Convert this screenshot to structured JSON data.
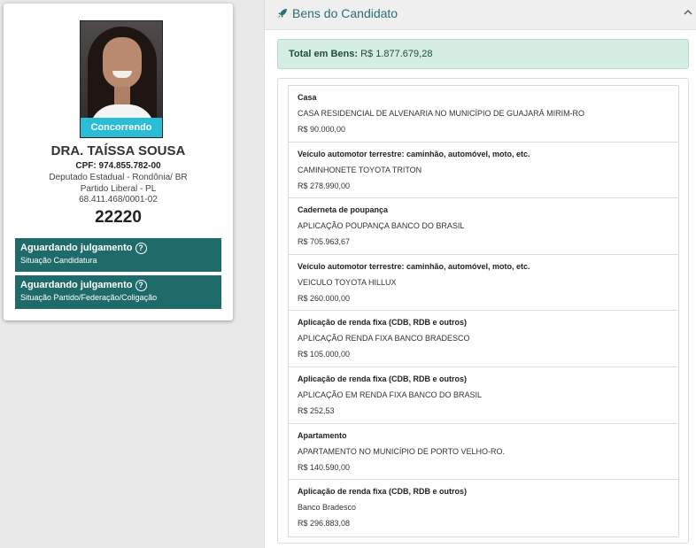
{
  "candidate": {
    "status_ribbon": "Concorrendo",
    "name": "DRA. TAÍSSA SOUSA",
    "cpf": "CPF: 974.855.782-00",
    "role": "Deputado Estadual - Rondônia/ BR",
    "party": "Partido Liberal - PL",
    "cnpj": "68.411.468/0001-02",
    "number": "22220",
    "situations": [
      {
        "title": "Aguardando julgamento",
        "subtitle": "Situação Candidatura"
      },
      {
        "title": "Aguardando julgamento",
        "subtitle": "Situação Partido/Federação/Coligação"
      }
    ]
  },
  "assets_panel": {
    "title": "Bens do Candidato",
    "header_icon": "rocket-icon",
    "collapse_icon": "chevron-up-icon",
    "total_label": "Total em Bens:",
    "total_value": "R$ 1.877.679,28",
    "items": [
      {
        "type": "Casa",
        "description": "CASA RESIDENCIAL DE ALVENARIA NO MUNICÍPIO DE GUAJARÁ MIRIM-RO",
        "value": "R$ 90.000,00"
      },
      {
        "type": "Veículo automotor terrestre: caminhão, automóvel, moto, etc.",
        "description": "CAMINHONETE TOYOTA TRITON",
        "value": "R$ 278.990,00"
      },
      {
        "type": "Caderneta de poupança",
        "description": "APLICAÇÃO POUPANÇA BANCO DO BRASIL",
        "value": "R$ 705.963,67"
      },
      {
        "type": "Veículo automotor terrestre: caminhão, automóvel, moto, etc.",
        "description": "VEICULO TOYOTA HILLUX",
        "value": "R$ 260.000,00"
      },
      {
        "type": "Aplicação de renda fixa (CDB, RDB e outros)",
        "description": "APLICAÇÃO RENDA FIXA BANCO BRADESCO",
        "value": "R$ 105.000,00"
      },
      {
        "type": "Aplicação de renda fixa (CDB, RDB e outros)",
        "description": "APLICAÇÃO EM RENDA FIXA BANCO DO BRASIL",
        "value": "R$ 252,53"
      },
      {
        "type": "Apartamento",
        "description": "APARTAMENTO NO MUNICÍPIO DE PORTO VELHO-RO.",
        "value": "R$ 140.590,00"
      },
      {
        "type": "Aplicação de renda fixa (CDB, RDB e outros)",
        "description": "Banco Bradesco",
        "value": "R$ 296.883,08"
      }
    ]
  },
  "colors": {
    "accent_teal": "#1f6b6a",
    "ribbon_cyan": "#2bbcd6",
    "total_bg": "#d5ede2",
    "title_teal": "#2c6f73"
  }
}
